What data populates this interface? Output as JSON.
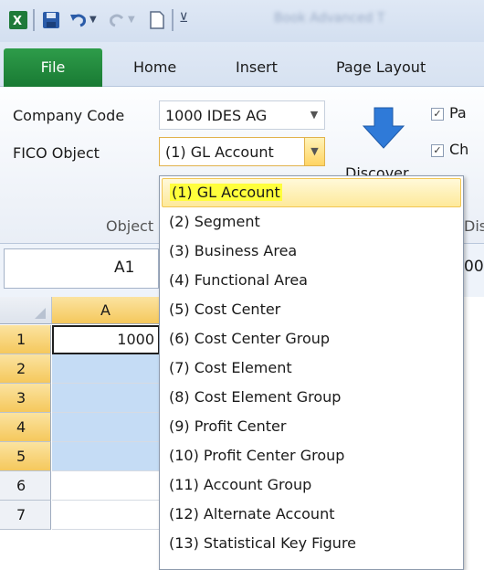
{
  "qat": {
    "title_blurred": "Book   Advanced   T"
  },
  "tabs": {
    "file": "File",
    "home": "Home",
    "insert": "Insert",
    "page_layout": "Page Layout"
  },
  "ribbon": {
    "company_code_label": "Company Code",
    "company_code_value": "1000 IDES AG",
    "fico_label": "FICO Object",
    "fico_value": "(1) GL Account",
    "discover_label": "Discover",
    "group_object": "Object",
    "group_dis": "Dis",
    "cb1_label": "Pa",
    "cb2_label": "Ch"
  },
  "formula": {
    "namebox": "A1",
    "content": "00"
  },
  "grid": {
    "col_a": "A",
    "rows": [
      "1",
      "2",
      "3",
      "4",
      "5",
      "6",
      "7"
    ],
    "a1_value": "1000"
  },
  "dropdown": {
    "options": [
      "(1) GL Account",
      "(2) Segment",
      "(3) Business Area",
      "(4) Functional Area",
      "(5) Cost Center",
      "(6) Cost Center Group",
      "(7) Cost Element",
      "(8) Cost Element Group",
      "(9) Profit Center",
      "(10) Profit Center Group",
      "(11) Account Group",
      "(12) Alternate Account",
      "(13) Statistical Key Figure"
    ],
    "selected_index": 0
  },
  "colors": {
    "accent_green": "#1f8a3b",
    "selection_blue": "#c5dcf5",
    "header_orange": "#f5c85c",
    "highlight_yellow": "#ffff3c"
  }
}
